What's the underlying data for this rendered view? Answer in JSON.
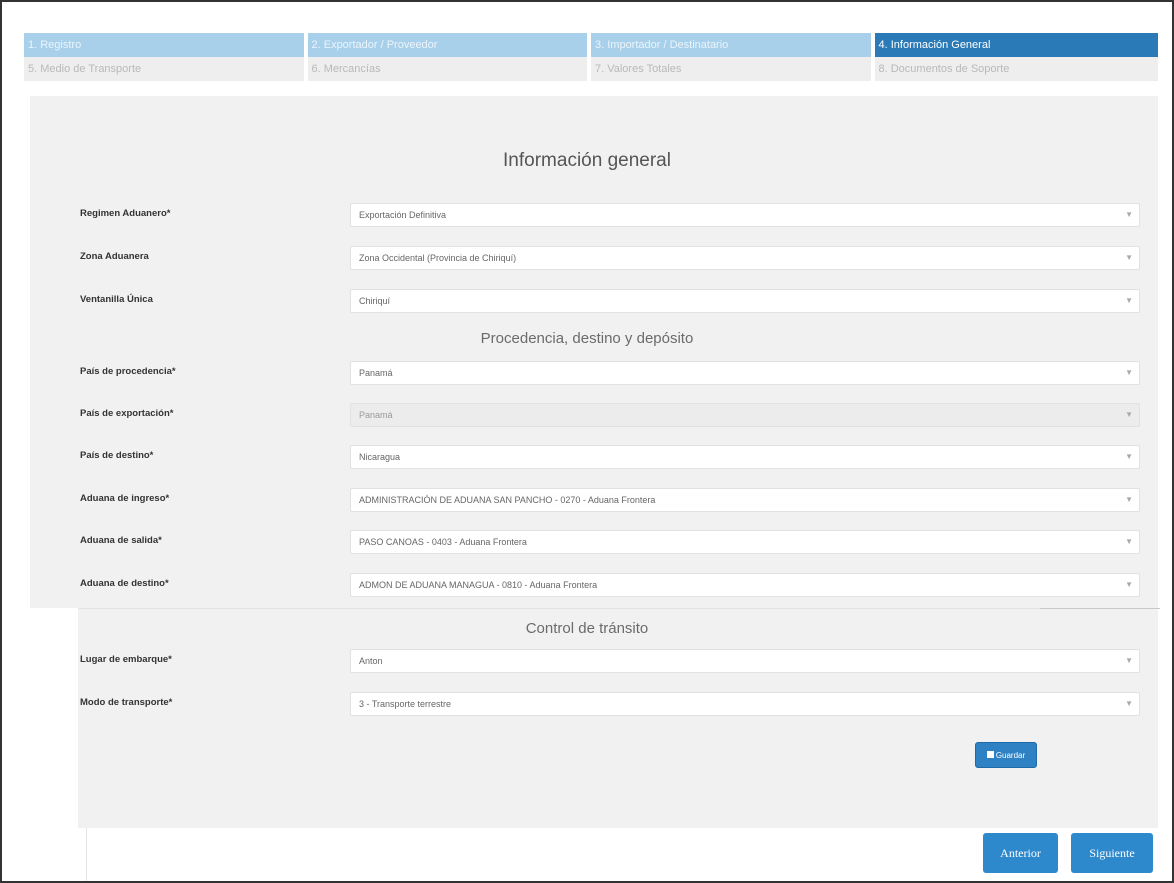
{
  "steps": [
    {
      "label": "1. Registro"
    },
    {
      "label": "2. Exportador / Proveedor"
    },
    {
      "label": "3. Importador / Destinatario"
    },
    {
      "label": "4. Información General"
    },
    {
      "label": "5. Medio de Transporte"
    },
    {
      "label": "6. Mercancías"
    },
    {
      "label": "7. Valores Totales"
    },
    {
      "label": "8. Documentos de Soporte"
    }
  ],
  "titles": {
    "main": "Información general",
    "procedencia": "Procedencia, destino y depósito",
    "control": "Control de tránsito"
  },
  "fields": {
    "regimen": {
      "label": "Regimen Aduanero*",
      "value": "Exportación Definitiva"
    },
    "zona": {
      "label": "Zona Aduanera",
      "value": "Zona Occidental (Provincia de Chiriquí)"
    },
    "ventanilla": {
      "label": "Ventanilla Única",
      "value": "Chiriquí"
    },
    "pais_procedencia": {
      "label": "País de procedencia*",
      "value": "Panamá"
    },
    "pais_exportacion": {
      "label": "País de exportación*",
      "value": "Panamá"
    },
    "pais_destino": {
      "label": "País de destino*",
      "value": "Nicaragua"
    },
    "aduana_ingreso": {
      "label": "Aduana de ingreso*",
      "value": "ADMINISTRACIÓN DE ADUANA SAN PANCHO - 0270 - Aduana Frontera"
    },
    "aduana_salida": {
      "label": "Aduana de salida*",
      "value": "PASO CANOAS - 0403 - Aduana Frontera"
    },
    "aduana_destino": {
      "label": "Aduana de destino*",
      "value": "ADMON DE ADUANA MANAGUA - 0810 - Aduana Frontera"
    },
    "lugar_embarque": {
      "label": "Lugar de embarque*",
      "value": "Anton"
    },
    "modo_transporte": {
      "label": "Modo de transporte*",
      "value": "3 - Transporte terrestre"
    }
  },
  "buttons": {
    "save": "Guardar",
    "prev": "Anterior",
    "next": "Siguiente"
  },
  "colors": {
    "step_inactive": "#a9d0ea",
    "step_active": "#2b7ab8",
    "button": "#2e88cc",
    "panel": "#f1f1f1"
  }
}
